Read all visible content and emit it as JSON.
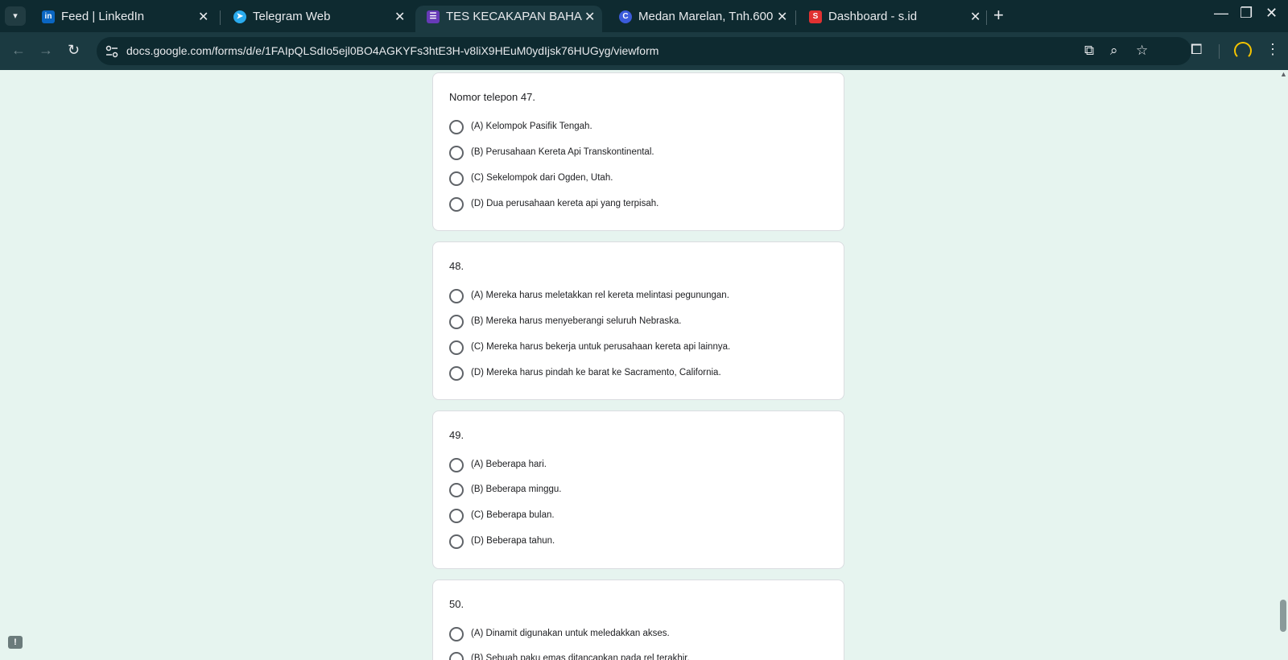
{
  "tabs": [
    {
      "title": "Feed | LinkedIn",
      "favicon": "linkedin-icon",
      "favicon_text": "in",
      "color": "#0a66c2"
    },
    {
      "title": "Telegram Web",
      "favicon": "telegram-icon",
      "favicon_text": "➤",
      "color": "#2aabee"
    },
    {
      "title": "TES KECAKAPAN BAHAS",
      "favicon": "google-forms-icon",
      "favicon_text": "☰",
      "color": "#673ab7",
      "active": true
    },
    {
      "title": "Medan Marelan, Tnh.600",
      "favicon": "canva-icon",
      "favicon_text": "C",
      "color": "#3b5bdb"
    },
    {
      "title": "Dashboard - s.id",
      "favicon": "sid-icon",
      "favicon_text": "S",
      "color": "#e03131"
    }
  ],
  "toolbar": {
    "url": "docs.google.com/forms/d/e/1FAIpQLSdIo5ejl0BO4AGKYFs3htE3H-v8liX9HEuM0ydIjsk76HUGyg/viewform"
  },
  "questions": [
    {
      "title": "Nomor telepon 47.",
      "options": [
        "(A) Kelompok Pasifik Tengah.",
        "(B) Perusahaan Kereta Api Transkontinental.",
        "(C) Sekelompok dari Ogden, Utah.",
        "(D) Dua perusahaan kereta api yang terpisah."
      ]
    },
    {
      "title": "48.",
      "options": [
        "(A) Mereka harus meletakkan rel kereta melintasi pegunungan.",
        "(B) Mereka harus menyeberangi seluruh Nebraska.",
        "(C) Mereka harus bekerja untuk perusahaan kereta api lainnya.",
        "(D) Mereka harus pindah ke barat ke Sacramento, California."
      ]
    },
    {
      "title": "49.",
      "options": [
        "(A) Beberapa hari.",
        "(B) Beberapa minggu.",
        "(C) Beberapa bulan.",
        "(D) Beberapa tahun."
      ]
    },
    {
      "title": "50.",
      "options": [
        "(A) Dinamit digunakan untuk meledakkan akses.",
        "(B) Sebuah paku emas ditancapkan pada rel terakhir."
      ]
    }
  ],
  "colors": {
    "page_background": "#e6f4ef",
    "card_background": "#ffffff",
    "tab_strip": "#0e2a30",
    "toolbar": "#1b3a41"
  }
}
